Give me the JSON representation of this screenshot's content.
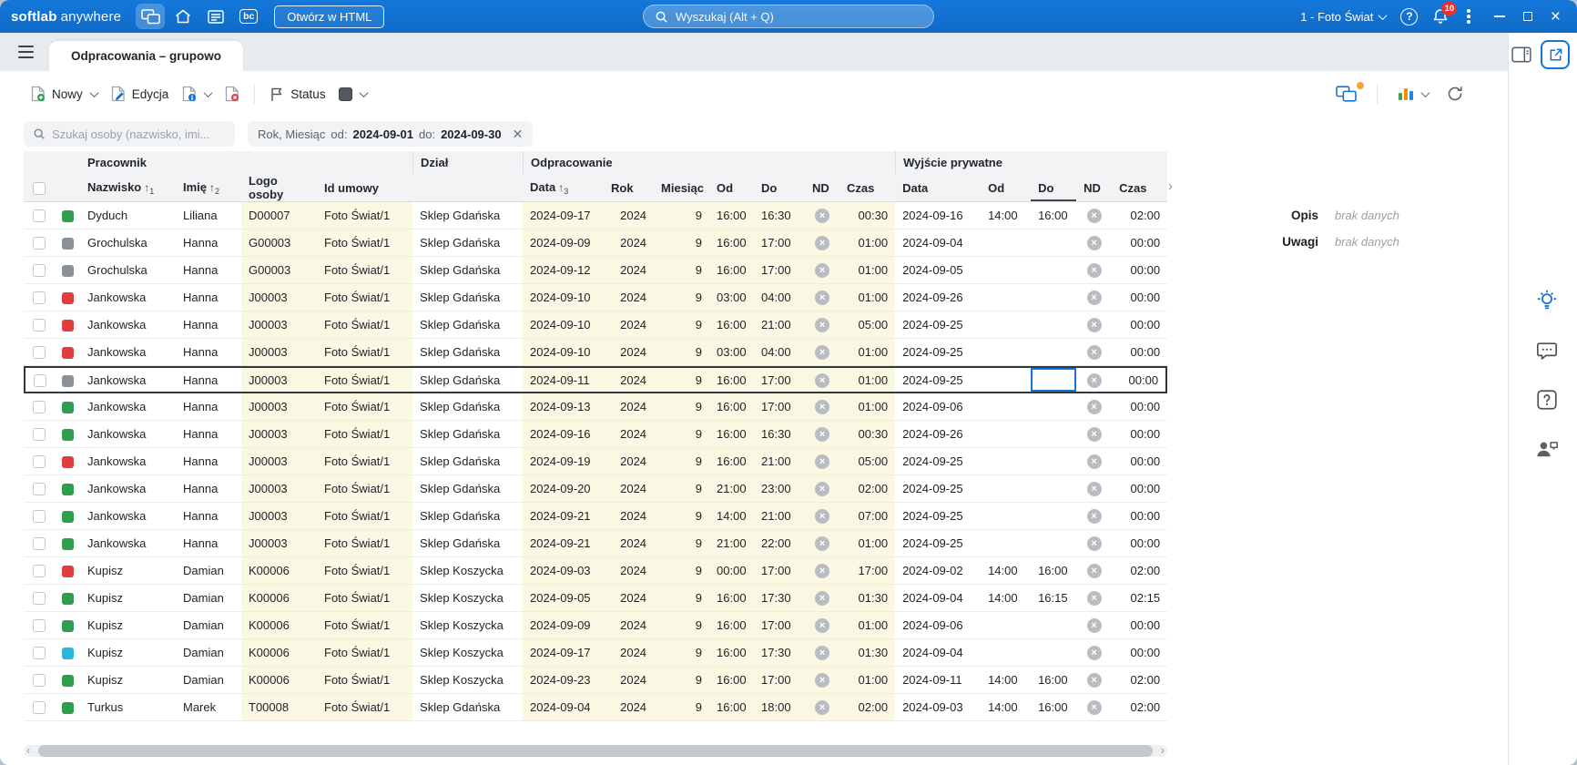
{
  "topbar": {
    "brand": {
      "bold": "softlab",
      "light": "anywhere"
    },
    "bc_label": "bc",
    "open_in_html": "Otwórz w HTML",
    "search_placeholder": "Wyszukaj (Alt + Q)",
    "company": "1 - Foto Świat",
    "notifications": "10"
  },
  "tabs": {
    "active": "Odpracowania – grupowo"
  },
  "toolbar": {
    "new": "Nowy",
    "edit": "Edycja",
    "status": "Status"
  },
  "filters": {
    "search_placeholder": "Szukaj osoby (nazwisko, imi...",
    "chip": {
      "name": "Rok, Miesiąc",
      "from_label": "od:",
      "from_value": "2024-09-01",
      "to_label": "do:",
      "to_value": "2024-09-30"
    }
  },
  "table": {
    "groups": {
      "pracownik": "Pracownik",
      "dzial": "Dział",
      "odpracowanie": "Odpracowanie",
      "wyjscie_prywatne": "Wyjście prywatne"
    },
    "header": {
      "nazwisko": "Nazwisko",
      "imie": "Imię",
      "logo": "Logo osoby",
      "umowa": "Id umowy",
      "data": "Data",
      "rok": "Rok",
      "miesiac": "Miesiąc",
      "od": "Od",
      "do": "Do",
      "nd": "ND",
      "czas": "Czas",
      "data2": "Data",
      "od2": "Od",
      "do2": "Do",
      "nd2": "ND",
      "czas2": "Czas"
    },
    "sort": {
      "nazwisko": "1",
      "imie": "2",
      "data": "3"
    },
    "status_colors": {
      "green": "#2f9e4f",
      "gray": "#8a9197",
      "red": "#e23d3d",
      "cyan": "#29b6d8"
    },
    "rows": [
      {
        "status": "green",
        "nazwisko": "Dyduch",
        "imie": "Liliana",
        "logo": "D00007",
        "umowa": "Foto Świat/1",
        "dzial": "Sklep Gdańska",
        "data1": "2024-09-17",
        "rok": "2024",
        "miesiac": "9",
        "od1": "16:00",
        "do1": "16:30",
        "czas1": "00:30",
        "data2": "2024-09-16",
        "od2": "14:00",
        "do2": "16:00",
        "czas2": "02:00"
      },
      {
        "status": "gray",
        "nazwisko": "Grochulska",
        "imie": "Hanna",
        "logo": "G00003",
        "umowa": "Foto Świat/1",
        "dzial": "Sklep Gdańska",
        "data1": "2024-09-09",
        "rok": "2024",
        "miesiac": "9",
        "od1": "16:00",
        "do1": "17:00",
        "czas1": "01:00",
        "data2": "2024-09-04",
        "od2": "",
        "do2": "",
        "czas2": "00:00"
      },
      {
        "status": "gray",
        "nazwisko": "Grochulska",
        "imie": "Hanna",
        "logo": "G00003",
        "umowa": "Foto Świat/1",
        "dzial": "Sklep Gdańska",
        "data1": "2024-09-12",
        "rok": "2024",
        "miesiac": "9",
        "od1": "16:00",
        "do1": "17:00",
        "czas1": "01:00",
        "data2": "2024-09-05",
        "od2": "",
        "do2": "",
        "czas2": "00:00"
      },
      {
        "status": "red",
        "nazwisko": "Jankowska",
        "imie": "Hanna",
        "logo": "J00003",
        "umowa": "Foto Świat/1",
        "dzial": "Sklep Gdańska",
        "data1": "2024-09-10",
        "rok": "2024",
        "miesiac": "9",
        "od1": "03:00",
        "do1": "04:00",
        "czas1": "01:00",
        "data2": "2024-09-26",
        "od2": "",
        "do2": "",
        "czas2": "00:00"
      },
      {
        "status": "red",
        "nazwisko": "Jankowska",
        "imie": "Hanna",
        "logo": "J00003",
        "umowa": "Foto Świat/1",
        "dzial": "Sklep Gdańska",
        "data1": "2024-09-10",
        "rok": "2024",
        "miesiac": "9",
        "od1": "16:00",
        "do1": "21:00",
        "czas1": "05:00",
        "data2": "2024-09-25",
        "od2": "",
        "do2": "",
        "czas2": "00:00"
      },
      {
        "status": "red",
        "nazwisko": "Jankowska",
        "imie": "Hanna",
        "logo": "J00003",
        "umowa": "Foto Świat/1",
        "dzial": "Sklep Gdańska",
        "data1": "2024-09-10",
        "rok": "2024",
        "miesiac": "9",
        "od1": "03:00",
        "do1": "04:00",
        "czas1": "01:00",
        "data2": "2024-09-25",
        "od2": "",
        "do2": "",
        "czas2": "00:00"
      },
      {
        "status": "gray",
        "nazwisko": "Jankowska",
        "imie": "Hanna",
        "logo": "J00003",
        "umowa": "Foto Świat/1",
        "dzial": "Sklep Gdańska",
        "data1": "2024-09-11",
        "rok": "2024",
        "miesiac": "9",
        "od1": "16:00",
        "do1": "17:00",
        "czas1": "01:00",
        "data2": "2024-09-25",
        "od2": "",
        "do2": "",
        "czas2": "00:00",
        "selected": true,
        "active_cell": "do2"
      },
      {
        "status": "green",
        "nazwisko": "Jankowska",
        "imie": "Hanna",
        "logo": "J00003",
        "umowa": "Foto Świat/1",
        "dzial": "Sklep Gdańska",
        "data1": "2024-09-13",
        "rok": "2024",
        "miesiac": "9",
        "od1": "16:00",
        "do1": "17:00",
        "czas1": "01:00",
        "data2": "2024-09-06",
        "od2": "",
        "do2": "",
        "czas2": "00:00"
      },
      {
        "status": "green",
        "nazwisko": "Jankowska",
        "imie": "Hanna",
        "logo": "J00003",
        "umowa": "Foto Świat/1",
        "dzial": "Sklep Gdańska",
        "data1": "2024-09-16",
        "rok": "2024",
        "miesiac": "9",
        "od1": "16:00",
        "do1": "16:30",
        "czas1": "00:30",
        "data2": "2024-09-26",
        "od2": "",
        "do2": "",
        "czas2": "00:00"
      },
      {
        "status": "red",
        "nazwisko": "Jankowska",
        "imie": "Hanna",
        "logo": "J00003",
        "umowa": "Foto Świat/1",
        "dzial": "Sklep Gdańska",
        "data1": "2024-09-19",
        "rok": "2024",
        "miesiac": "9",
        "od1": "16:00",
        "do1": "21:00",
        "czas1": "05:00",
        "data2": "2024-09-25",
        "od2": "",
        "do2": "",
        "czas2": "00:00"
      },
      {
        "status": "green",
        "nazwisko": "Jankowska",
        "imie": "Hanna",
        "logo": "J00003",
        "umowa": "Foto Świat/1",
        "dzial": "Sklep Gdańska",
        "data1": "2024-09-20",
        "rok": "2024",
        "miesiac": "9",
        "od1": "21:00",
        "do1": "23:00",
        "czas1": "02:00",
        "data2": "2024-09-25",
        "od2": "",
        "do2": "",
        "czas2": "00:00"
      },
      {
        "status": "green",
        "nazwisko": "Jankowska",
        "imie": "Hanna",
        "logo": "J00003",
        "umowa": "Foto Świat/1",
        "dzial": "Sklep Gdańska",
        "data1": "2024-09-21",
        "rok": "2024",
        "miesiac": "9",
        "od1": "14:00",
        "do1": "21:00",
        "czas1": "07:00",
        "data2": "2024-09-25",
        "od2": "",
        "do2": "",
        "czas2": "00:00"
      },
      {
        "status": "green",
        "nazwisko": "Jankowska",
        "imie": "Hanna",
        "logo": "J00003",
        "umowa": "Foto Świat/1",
        "dzial": "Sklep Gdańska",
        "data1": "2024-09-21",
        "rok": "2024",
        "miesiac": "9",
        "od1": "21:00",
        "do1": "22:00",
        "czas1": "01:00",
        "data2": "2024-09-25",
        "od2": "",
        "do2": "",
        "czas2": "00:00"
      },
      {
        "status": "red",
        "nazwisko": "Kupisz",
        "imie": "Damian",
        "logo": "K00006",
        "umowa": "Foto Świat/1",
        "dzial": "Sklep Koszycka",
        "data1": "2024-09-03",
        "rok": "2024",
        "miesiac": "9",
        "od1": "00:00",
        "do1": "17:00",
        "czas1": "17:00",
        "data2": "2024-09-02",
        "od2": "14:00",
        "do2": "16:00",
        "czas2": "02:00"
      },
      {
        "status": "green",
        "nazwisko": "Kupisz",
        "imie": "Damian",
        "logo": "K00006",
        "umowa": "Foto Świat/1",
        "dzial": "Sklep Koszycka",
        "data1": "2024-09-05",
        "rok": "2024",
        "miesiac": "9",
        "od1": "16:00",
        "do1": "17:30",
        "czas1": "01:30",
        "data2": "2024-09-04",
        "od2": "14:00",
        "do2": "16:15",
        "czas2": "02:15"
      },
      {
        "status": "green",
        "nazwisko": "Kupisz",
        "imie": "Damian",
        "logo": "K00006",
        "umowa": "Foto Świat/1",
        "dzial": "Sklep Koszycka",
        "data1": "2024-09-09",
        "rok": "2024",
        "miesiac": "9",
        "od1": "16:00",
        "do1": "17:00",
        "czas1": "01:00",
        "data2": "2024-09-06",
        "od2": "",
        "do2": "",
        "czas2": "00:00"
      },
      {
        "status": "cyan",
        "nazwisko": "Kupisz",
        "imie": "Damian",
        "logo": "K00006",
        "umowa": "Foto Świat/1",
        "dzial": "Sklep Koszycka",
        "data1": "2024-09-17",
        "rok": "2024",
        "miesiac": "9",
        "od1": "16:00",
        "do1": "17:30",
        "czas1": "01:30",
        "data2": "2024-09-04",
        "od2": "",
        "do2": "",
        "czas2": "00:00"
      },
      {
        "status": "green",
        "nazwisko": "Kupisz",
        "imie": "Damian",
        "logo": "K00006",
        "umowa": "Foto Świat/1",
        "dzial": "Sklep Koszycka",
        "data1": "2024-09-23",
        "rok": "2024",
        "miesiac": "9",
        "od1": "16:00",
        "do1": "17:00",
        "czas1": "01:00",
        "data2": "2024-09-11",
        "od2": "14:00",
        "do2": "16:00",
        "czas2": "02:00"
      },
      {
        "status": "green",
        "nazwisko": "Turkus",
        "imie": "Marek",
        "logo": "T00008",
        "umowa": "Foto Świat/1",
        "dzial": "Sklep Gdańska",
        "data1": "2024-09-04",
        "rok": "2024",
        "miesiac": "9",
        "od1": "16:00",
        "do1": "18:00",
        "czas1": "02:00",
        "data2": "2024-09-03",
        "od2": "14:00",
        "do2": "16:00",
        "czas2": "02:00"
      }
    ]
  },
  "details": {
    "opis_label": "Opis",
    "opis_value": "brak danych",
    "uwagi_label": "Uwagi",
    "uwagi_value": "brak danych"
  }
}
